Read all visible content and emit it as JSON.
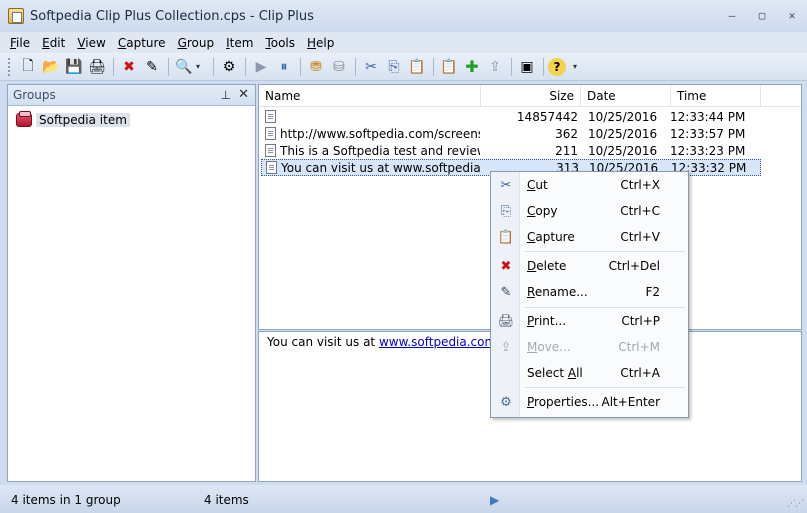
{
  "window": {
    "title": "Softpedia Clip Plus Collection.cps - Clip Plus",
    "buttons": {
      "minimize": "‒",
      "restore": "▢",
      "close": "✕"
    }
  },
  "menu": [
    {
      "label": "File",
      "accel": "F",
      "rest": "ile"
    },
    {
      "label": "Edit",
      "accel": "E",
      "rest": "dit"
    },
    {
      "label": "View",
      "accel": "V",
      "rest": "iew"
    },
    {
      "label": "Capture",
      "accel": "C",
      "rest": "apture"
    },
    {
      "label": "Group",
      "accel": "G",
      "rest": "roup"
    },
    {
      "label": "Item",
      "accel": "I",
      "rest": "tem"
    },
    {
      "label": "Tools",
      "accel": "T",
      "rest": "ools"
    },
    {
      "label": "Help",
      "accel": "H",
      "rest": "elp"
    }
  ],
  "toolbar_icons": {
    "new": "🗋",
    "open": "📂",
    "save": "💾",
    "print": "🖨",
    "delete": "✖",
    "rename": "✎",
    "find": "🔍",
    "properties": "⚙",
    "play": "▶",
    "pause": "⏸",
    "db1": "⛃",
    "db2": "⛁",
    "cut": "✂",
    "copy": "⎘",
    "paste": "📋",
    "capture": "📋",
    "add": "✚",
    "export": "⇪",
    "select": "▣",
    "help": "?",
    "more": "▾",
    "drop": "▾"
  },
  "groups": {
    "title": "Groups",
    "pin": "⊥",
    "close": "✕",
    "items": [
      "Softpedia item"
    ]
  },
  "list": {
    "columns": [
      "Name",
      "Size",
      "Date",
      "Time"
    ],
    "rows": [
      {
        "name": "",
        "size": "14857442",
        "date": "10/25/2016",
        "time": "12:33:44 PM"
      },
      {
        "name": "http://www.softpedia.com/screenshot...",
        "size": "362",
        "date": "10/25/2016",
        "time": "12:33:57 PM"
      },
      {
        "name": "This is a Softpedia test and review",
        "size": "211",
        "date": "10/25/2016",
        "time": "12:33:23 PM"
      },
      {
        "name": "You can visit us at www.softpedia.com",
        "size": "313",
        "date": "10/25/2016",
        "time": "12:33:32 PM"
      }
    ]
  },
  "preview": {
    "prefix": "You can visit us at ",
    "link": "www.softpedia.com"
  },
  "context_menu": [
    {
      "accel": "C",
      "label_rest": "ut",
      "label": "Cut",
      "key": "Ctrl+X",
      "icon": "✂",
      "icon_color": "#3a5fa0",
      "disabled": false
    },
    {
      "accel": "C",
      "label_rest": "opy",
      "label": "Copy",
      "key": "Ctrl+C",
      "icon": "⎘",
      "icon_color": "#3a5fa0",
      "disabled": false
    },
    {
      "accel": "C",
      "label_rest": "apture",
      "label": "Capture",
      "key": "Ctrl+V",
      "icon": "📋",
      "icon_color": "#b08a20",
      "disabled": false
    },
    {
      "accel": "D",
      "label_rest": "elete",
      "label": "Delete",
      "key": "Ctrl+Del",
      "icon": "✖",
      "icon_color": "#d01010",
      "disabled": false
    },
    {
      "accel": "R",
      "label_rest": "ename...",
      "label": "Rename...",
      "key": "F2",
      "icon": "✎",
      "icon_color": "#34465e",
      "disabled": false
    },
    {
      "accel": "P",
      "label_rest": "rint...",
      "label": "Print...",
      "key": "Ctrl+P",
      "icon": "🖨",
      "icon_color": "#4a5566",
      "disabled": false
    },
    {
      "accel": "M",
      "label_rest": "ove...",
      "label": "Move...",
      "key": "Ctrl+M",
      "icon": "⇪",
      "icon_color": "#a0a8b4",
      "disabled": true
    },
    {
      "accel": "A",
      "label_prefix": "Select ",
      "label_rest": "ll",
      "label": "Select All",
      "key": "Ctrl+A",
      "icon": "",
      "icon_color": "#000000",
      "disabled": false
    },
    {
      "accel": "P",
      "label_rest": "roperties...",
      "label": "Properties...",
      "key": "Alt+Enter",
      "icon": "⚙",
      "icon_color": "#4a6a90",
      "disabled": false
    }
  ],
  "status": {
    "items_text": "4 items in 1 group",
    "count_text": "4 items",
    "play": "▶",
    "grip": "⋰⋰"
  },
  "colors": {
    "chrome": "#cfdbee",
    "selection": "#d7e6fb",
    "link": "#0000cc",
    "delete_red": "#d01010",
    "add_green": "#1e9e1e"
  }
}
